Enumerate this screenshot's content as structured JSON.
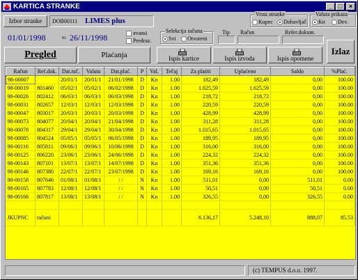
{
  "window": {
    "title": "KARTICA STRANKE"
  },
  "header": {
    "izbor_label": "Izbor stranke",
    "client_code": "DOB00111",
    "client_name": "LIMES plus",
    "vrsta_label": "Vrsta stranke",
    "kupac": "Kupec",
    "dobavljac": "Dobavljač",
    "valuta_label": "Valuta prikaza",
    "kn": "Kn",
    "dev": "Dev.",
    "date_from": "01/01/1998",
    "date_to_label": "to",
    "date_to": "26/11/1998",
    "avansi": "avansi",
    "predraz": "Predraz.",
    "selekcija_label": "Selekcija računa",
    "svi": "Svi",
    "otvoreni": "Otvoreni",
    "tip_label": "Tip",
    "racun_label": "Račun",
    "refer_label": "Refer.dokum."
  },
  "toolbar": {
    "pregled": "Pregled",
    "placanja": "Plaćanja",
    "ispis_kartice": "Ispis kartice",
    "ispis_izvoda": "Ispis izvoda",
    "ispis_opomene": "Ispis opomene",
    "izlaz": "Izlaz"
  },
  "table": {
    "columns": [
      "Račun",
      "Ref.dok.",
      "Dat.rač.",
      "Valuta",
      "Dat.plać.",
      "P",
      "Val.",
      "Tečaj",
      "Za platiti",
      "Uplaćeno",
      "Saldo",
      "%Plać."
    ],
    "rows": [
      [
        "98-00007",
        "",
        "20/01/1",
        "20/01/1",
        "21/01/1998",
        "D",
        "Kn",
        "1.00",
        "182,49",
        "182,49",
        "0,00",
        "100.00"
      ],
      [
        "98-00019",
        "801460",
        "05/02/1",
        "05/02/1",
        "06/02/1998",
        "D",
        "Kn",
        "1.00",
        "1.625,59",
        "1.625,59",
        "0,00",
        "100.00"
      ],
      [
        "98-00026",
        "802412",
        "06/03/1",
        "06/03/1",
        "06/03/1998",
        "D",
        "Kn",
        "1.00",
        "218,72",
        "218,72",
        "0,00",
        "100.00"
      ],
      [
        "98-00031",
        "802657",
        "12/03/1",
        "12/03/1",
        "12/03/1998",
        "D",
        "Kn",
        "1.00",
        "220,59",
        "220,59",
        "0,00",
        "100.00"
      ],
      [
        "98-00047",
        "803017",
        "20/03/1",
        "20/03/1",
        "20/03/1998",
        "D",
        "Kn",
        "1.00",
        "428,99",
        "428,99",
        "0,00",
        "100.00"
      ],
      [
        "98-00073",
        "804077",
        "20/04/1",
        "20/04/1",
        "21/04/1998",
        "D",
        "Kn",
        "1.00",
        "311,28",
        "311,28",
        "0,00",
        "100.00"
      ],
      [
        "98-00078",
        "804317",
        "29/04/1",
        "29/04/1",
        "30/04/1998",
        "D",
        "Kn",
        "1.00",
        "1.015,65",
        "1.015,65",
        "0,00",
        "100.00"
      ],
      [
        "98-00085",
        "804524",
        "05/05/1",
        "05/05/1",
        "06/05/1998",
        "D",
        "Kn",
        "1.00",
        "189,95",
        "189,95",
        "0,00",
        "100.00"
      ],
      [
        "98-00116",
        "805811",
        "09/06/1",
        "09/06/1",
        "10/06/1998",
        "D",
        "Kn",
        "1.00",
        "316,00",
        "316,00",
        "0,00",
        "100.00"
      ],
      [
        "98-00125",
        "806220",
        "23/06/1",
        "23/06/1",
        "24/06/1998",
        "D",
        "Kn",
        "1.00",
        "224,32",
        "224,32",
        "0,00",
        "100.00"
      ],
      [
        "98-00143",
        "807101",
        "13/07/1",
        "13/07/1",
        "14/07/1998",
        "D",
        "Kn",
        "1.00",
        "351,36",
        "351,36",
        "0,00",
        "100.00"
      ],
      [
        "98-00146",
        "807380",
        "22/07/1",
        "22/07/1",
        "23/07/1998",
        "D",
        "Kn",
        "1.00",
        "169,16",
        "169,16",
        "0,00",
        "100.00"
      ],
      [
        "98-00158",
        "807646",
        "01/08/1",
        "01/08/1",
        "  /  /",
        "N",
        "Kn",
        "1.00",
        "511,01",
        "0,00",
        "511,01",
        "0.00"
      ],
      [
        "98-00165",
        "807783",
        "12/08/1",
        "12/08/1",
        "  /  /",
        "N",
        "Kn",
        "1.00",
        "50,51",
        "0,00",
        "50,51",
        "0.00"
      ],
      [
        "98-00166",
        "807817",
        "13/08/1",
        "13/08/1",
        "  /  /",
        "N",
        "Kn",
        "1.00",
        "326,55",
        "0,00",
        "326,55",
        "0.00"
      ],
      [
        "",
        "",
        "",
        "",
        "",
        "",
        "",
        "",
        "",
        "",
        "",
        ""
      ],
      [
        "JKUPNC",
        "računi",
        "",
        "",
        "",
        "",
        "",
        "",
        "6.136,17",
        "5.248,10",
        "888,07",
        "85.53"
      ]
    ]
  },
  "status": {
    "left": "",
    "copyright": "(c) TEMPUS d.o.o. 1997."
  }
}
